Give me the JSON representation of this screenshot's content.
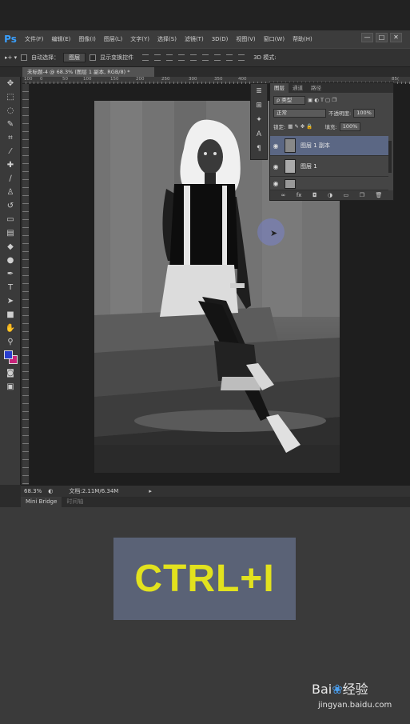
{
  "app": {
    "logo": "Ps",
    "menu": [
      "文件(F)",
      "编辑(E)",
      "图像(I)",
      "图层(L)",
      "文字(Y)",
      "选择(S)",
      "滤镜(T)",
      "3D(D)",
      "视图(V)",
      "窗口(W)",
      "帮助(H)"
    ],
    "window_controls": [
      "—",
      "□",
      "✕"
    ]
  },
  "options_bar": {
    "move_tool_label": "▸+ ▾",
    "auto_select_label": "自动选择：",
    "auto_select_value": "图层",
    "show_transform_label": "显示变换控件",
    "mode_3d_label": "3D 模式:"
  },
  "document": {
    "tab_title": "未标题-4 @ 68.3% (图层 1 副本, RGB/8) *",
    "ruler_ticks": [
      "100",
      "50",
      "0",
      "50",
      "100",
      "150",
      "200",
      "250",
      "300",
      "350",
      "400"
    ],
    "ruler_right": "85("
  },
  "status": {
    "zoom": "68.3%",
    "doc_info": "文档:2.11M/6.34M"
  },
  "bottom_tabs": [
    "Mini Bridge",
    "时间轴"
  ],
  "layers_panel": {
    "tabs": [
      "图层",
      "通道",
      "路径"
    ],
    "filter_label": "ρ 类型",
    "blend_mode": "正常",
    "opacity_label": "不透明度:",
    "opacity_value": "100%",
    "lock_label": "锁定:",
    "fill_label": "填充:",
    "fill_value": "100%",
    "layers": [
      {
        "name": "图层 1 副本",
        "selected": true
      },
      {
        "name": "图层 1",
        "selected": false
      }
    ],
    "footer_icons": [
      "link-icon",
      "fx-icon",
      "mask-icon",
      "adjustment-icon",
      "group-icon",
      "new-layer-icon",
      "trash-icon"
    ]
  },
  "hotkey": {
    "text": "CTRL+I",
    "text_color": "#e2e21e",
    "box_color": "#5a6276"
  },
  "watermark": {
    "brand_prefix": "Bai",
    "brand_suffix": "经验",
    "url": "jingyan.baidu.com"
  },
  "colors": {
    "accent": "#3aa0ff",
    "selection": "#5b6784",
    "foreground_swatch": "#2a3fcf",
    "background_swatch": "#c8247a"
  }
}
